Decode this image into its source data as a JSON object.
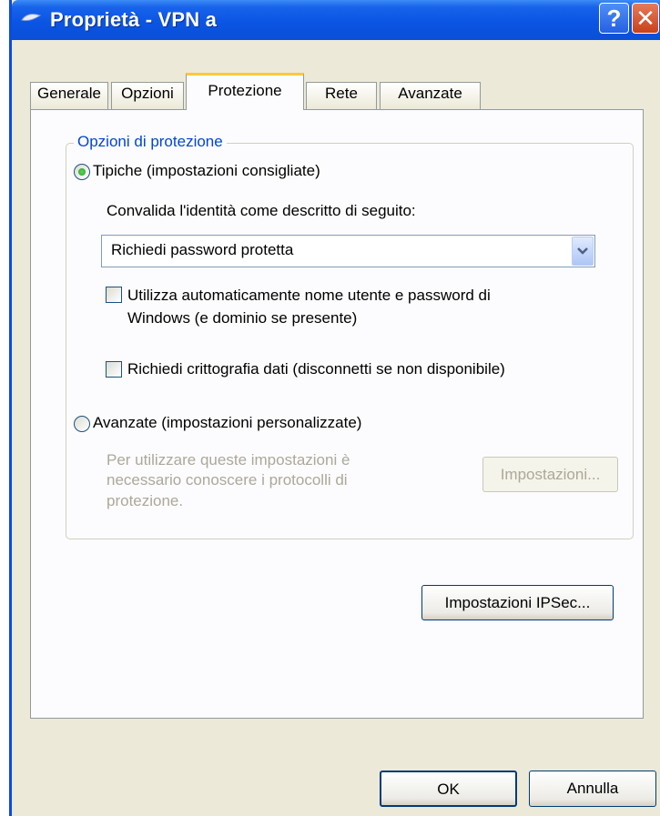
{
  "window": {
    "title": "Proprietà - VPN a",
    "help_glyph": "?",
    "close_glyph": "✕"
  },
  "tabs": [
    {
      "label": "Generale",
      "active": false
    },
    {
      "label": "Opzioni",
      "active": false
    },
    {
      "label": "Protezione",
      "active": true
    },
    {
      "label": "Rete",
      "active": false
    },
    {
      "label": "Avanzate",
      "active": false
    }
  ],
  "security": {
    "group_title": "Opzioni di protezione",
    "typical_label": "Tipiche (impostazioni consigliate)",
    "typical_selected": true,
    "validate_label": "Convalida l'identità come descritto di seguito:",
    "validate_value": "Richiedi password protetta",
    "auto_logon_line1": "Utilizza automaticamente nome utente e password di",
    "auto_logon_line2": "Windows (e dominio se presente)",
    "auto_logon_checked": false,
    "encryption_label": "Richiedi crittografia dati (disconnetti se non disponibile)",
    "encryption_checked": false,
    "advanced_label": "Avanzate (impostazioni personalizzate)",
    "advanced_selected": false,
    "advanced_note_line1": "Per utilizzare queste impostazioni è",
    "advanced_note_line2": "necessario conoscere i protocolli di",
    "advanced_note_line3": "protezione.",
    "settings_button": "Impostazioni...",
    "ipsec_button": "Impostazioni IPSec..."
  },
  "footer": {
    "ok_label": "OK",
    "cancel_label": "Annulla"
  },
  "colors": {
    "titlebar": "#0a4fd6",
    "group_title": "#0046d5",
    "tab_highlight": "#ffc73c"
  }
}
